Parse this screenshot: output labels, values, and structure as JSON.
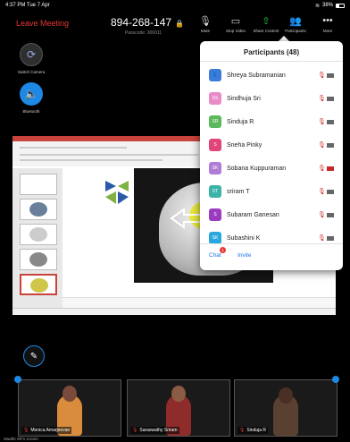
{
  "status_bar": {
    "time": "4:37 PM  Tue 7 Apr",
    "battery": "38%",
    "battery_level": 0.38
  },
  "top_bar": {
    "leave_label": "Leave Meeting",
    "meeting_id": "894-268-147",
    "passcode": "Passcode: 306011",
    "tools": [
      {
        "label": "Mute",
        "icon": "mic-icon"
      },
      {
        "label": "Stop Video",
        "icon": "video-icon"
      },
      {
        "label": "Share Content",
        "icon": "share-icon"
      },
      {
        "label": "Participants",
        "icon": "participants-icon"
      },
      {
        "label": "More",
        "icon": "more-icon"
      }
    ]
  },
  "left_buttons": {
    "camera_label": "Switch Camera",
    "bluetooth_label": "Bluetooth"
  },
  "participants": {
    "title": "Participants (48)",
    "list": [
      {
        "name": "Shreya Subramanian",
        "initials": "",
        "color": "#3d7bd9"
      },
      {
        "name": "Sindhuja Sri",
        "initials": "SS",
        "color": "#e88bc7"
      },
      {
        "name": "Sinduja R",
        "initials": "SR",
        "color": "#5cb85c"
      },
      {
        "name": "Sneha Pinky",
        "initials": "S",
        "color": "#e0447a"
      },
      {
        "name": "Sobana Kuppuraman",
        "initials": "SK",
        "color": "#b07cd6"
      },
      {
        "name": "sriram T",
        "initials": "ST",
        "color": "#3bb3a9"
      },
      {
        "name": "Subaram Ganesan",
        "initials": "S",
        "color": "#9c3bbf"
      },
      {
        "name": "Subashini K",
        "initials": "SK",
        "color": "#29a8e0"
      }
    ],
    "chat_label": "Chat",
    "chat_badge": "1",
    "invite_label": "Invite"
  },
  "videos": [
    {
      "name": "Monica Amarjeevan",
      "skin": "#7a4b3a",
      "shirt": "#d98c3c"
    },
    {
      "name": "Saraswathy Sriram",
      "skin": "#8a5c46",
      "shirt": "#8e2c2c"
    },
    {
      "name": "Sinduja R",
      "skin": "#4a2f24",
      "shirt": "#5a4030"
    }
  ],
  "screen_note": "Swathi SR's screen"
}
